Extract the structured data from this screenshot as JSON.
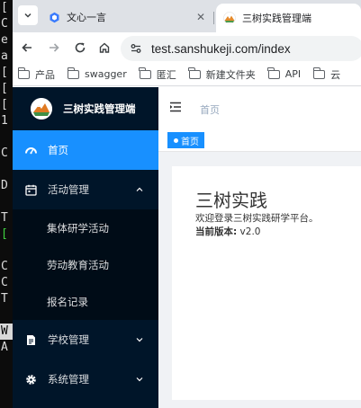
{
  "terminal": {
    "lines": [
      "[",
      "C",
      "e",
      "a",
      "[",
      "[",
      "[",
      "1",
      "",
      "C",
      "",
      "D",
      "",
      "T",
      "[",
      "",
      "C",
      "C",
      "T",
      "",
      "W",
      "A"
    ]
  },
  "browser": {
    "tabs": [
      {
        "title": "文心一言",
        "active": false
      },
      {
        "title": "三树实践管理端",
        "active": true
      }
    ],
    "url": "test.sanshukeji.com/index",
    "bookmarks": [
      "产品",
      "swagger",
      "匿汇",
      "新建文件夹",
      "API",
      "云"
    ]
  },
  "app": {
    "logo_text": "三树实践管理端",
    "menu": [
      {
        "label": "首页",
        "icon": "dashboard-icon",
        "active": true
      },
      {
        "label": "活动管理",
        "icon": "calendar-icon",
        "open": true,
        "children": [
          "集体研学活动",
          "劳动教育活动",
          "报名记录"
        ]
      },
      {
        "label": "学校管理",
        "icon": "document-icon"
      },
      {
        "label": "系统管理",
        "icon": "gear-icon"
      }
    ],
    "breadcrumb": "首页",
    "tag": "首页",
    "welcome": {
      "title": "三树实践",
      "subtitle": "欢迎登录三树实践研学平台。",
      "version_label": "当前版本:",
      "version_value": "v2.0"
    }
  },
  "colors": {
    "sidebar_bg": "#001529",
    "submenu_bg": "#000c17",
    "accent": "#1890ff",
    "content_bg": "#f0f2f5"
  }
}
